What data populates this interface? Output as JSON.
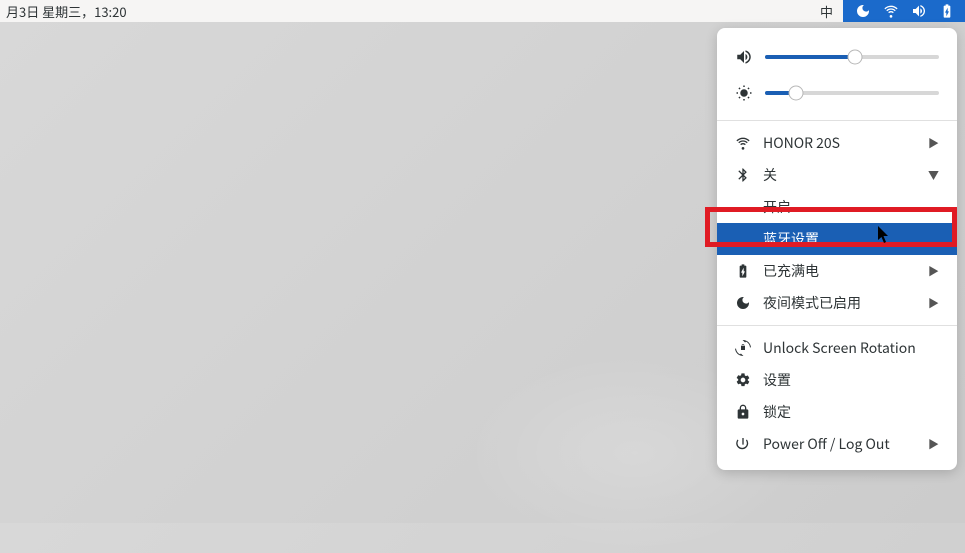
{
  "topbar": {
    "datetime": "月3日 星期三，13:20",
    "ime": "中"
  },
  "sliders": {
    "volume_percent": 52,
    "brightness_percent": 18
  },
  "menu": {
    "wifi_label": "HONOR 20S",
    "bluetooth_label": "关",
    "bluetooth_sub_on": "开启",
    "bluetooth_sub_settings": "蓝牙设置",
    "power_label": "已充满电",
    "night_label": "夜间模式已启用",
    "rotation_label": "Unlock Screen Rotation",
    "settings_label": "设置",
    "lock_label": "锁定",
    "poweroff_label": "Power Off / Log Out"
  }
}
